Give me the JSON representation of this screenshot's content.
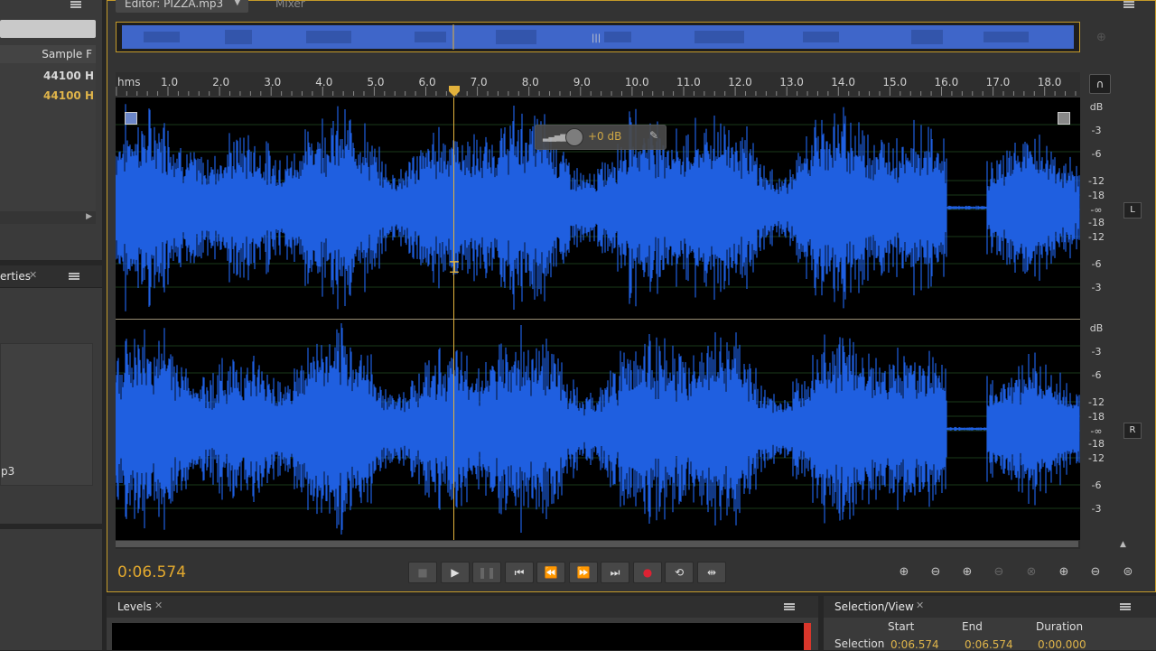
{
  "left_top_panel": {
    "column_header": "Sample F",
    "rows": [
      {
        "value": "44100 H",
        "active": false
      },
      {
        "value": "44100 H",
        "active": true
      }
    ]
  },
  "properties_panel": {
    "tab_label": "erties",
    "file_stub": "p3"
  },
  "editor": {
    "tab_label": "Editor: PIZZA.mp3",
    "mixer_tab": "Mixer",
    "ruler_unit": "hms",
    "ruler_ticks": [
      "1.0",
      "2.0",
      "3.0",
      "4.0",
      "5.0",
      "6.0",
      "7.0",
      "8.0",
      "9.0",
      "10.0",
      "11.0",
      "12.0",
      "13.0",
      "14.0",
      "15.0",
      "16.0",
      "17.0",
      "18.0"
    ],
    "hud_gain": "+0 dB",
    "db_scale_top": [
      "dB",
      "-3",
      "-6",
      "-12",
      "-18",
      "-∞",
      "-18",
      "-12",
      "-6",
      "-3"
    ],
    "db_scale_bottom": [
      "dB",
      "-3",
      "-6",
      "-12",
      "-18",
      "-∞",
      "-18",
      "-12",
      "-6",
      "-3"
    ],
    "channel_left": "L",
    "channel_right": "R",
    "current_time": "0:06.574",
    "waveform_color": "#1f5fe0",
    "playhead_color": "#e3b23c"
  },
  "levels_panel": {
    "tab_label": "Levels"
  },
  "selection_panel": {
    "tab_label": "Selection/View",
    "headers": [
      "Start",
      "End",
      "Duration"
    ],
    "row_label": "Selection",
    "start": "0:06.574",
    "end": "0:06.574",
    "duration": "0:00.000"
  }
}
